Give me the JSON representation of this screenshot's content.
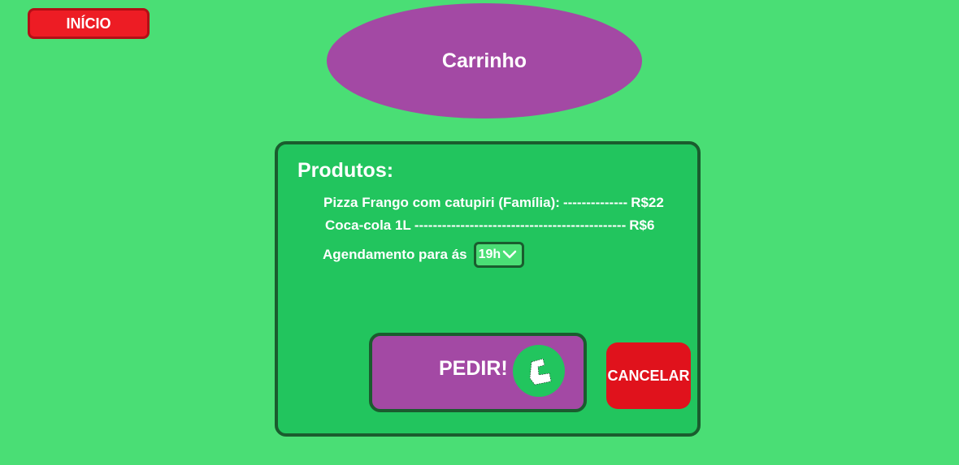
{
  "header": {
    "home_label": "INÍCIO",
    "title": "Carrinho"
  },
  "cart": {
    "heading": "Produtos:",
    "items": [
      {
        "name": "Pizza Frango com catupiri (Família):",
        "dashes": "--------------",
        "price": "R$22"
      },
      {
        "name": "Coca-cola 1L",
        "dashes": "----------------------------------------------",
        "price": "R$6"
      }
    ],
    "schedule_label": "Agendamento para ás",
    "schedule_time": "19h"
  },
  "actions": {
    "order_label": "PEDIR!",
    "order_icon": "cart-icon",
    "cancel_label": "CANCELAR"
  },
  "colors": {
    "background": "#4ade75",
    "panel": "#22c55e",
    "accent_purple": "#a349a4",
    "danger_red": "#ed1c24"
  }
}
